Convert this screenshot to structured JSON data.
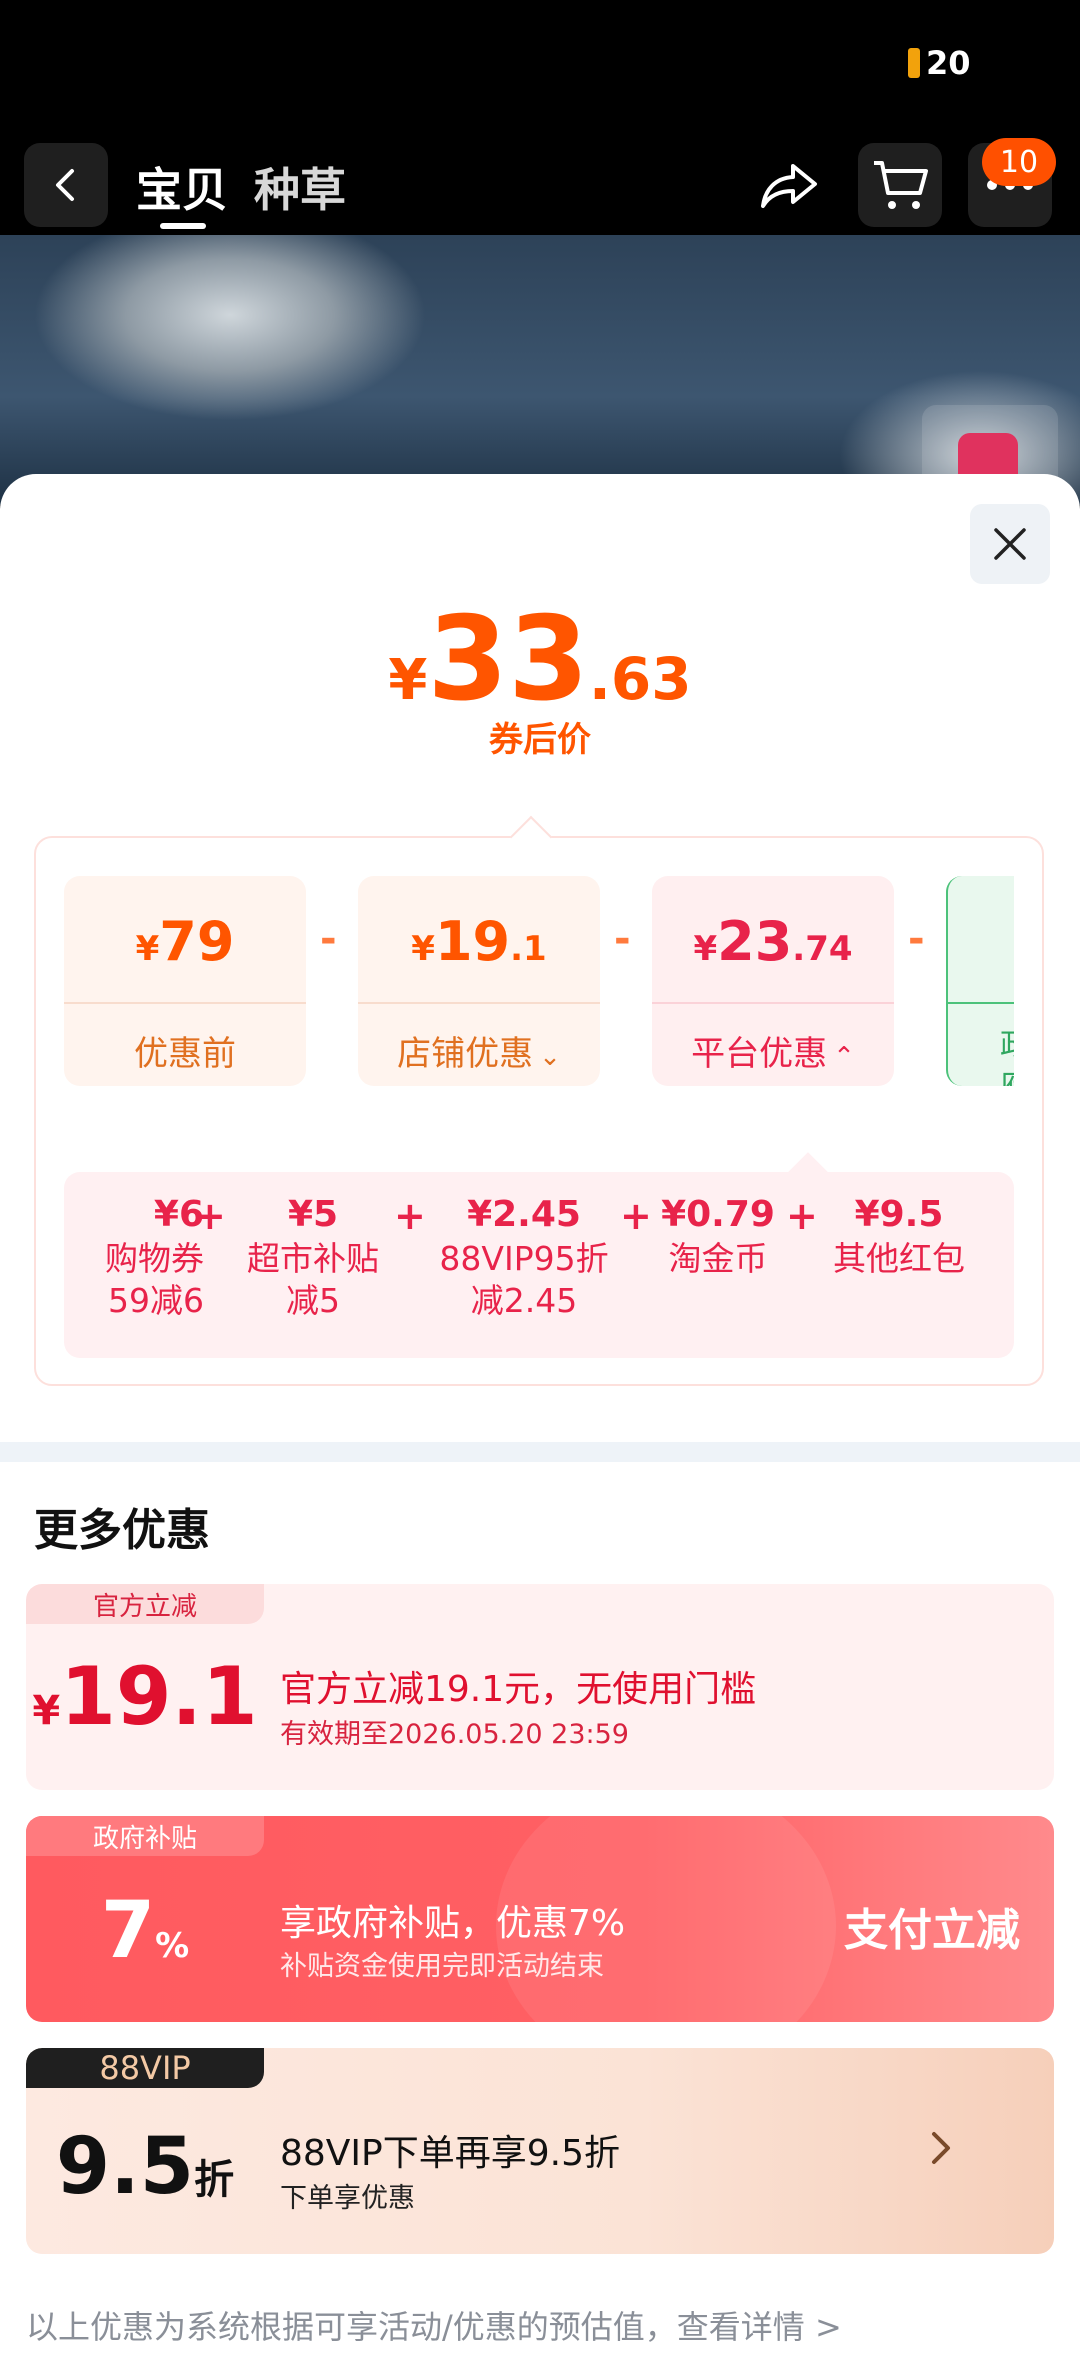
{
  "status_bar": {
    "battery_level": "20"
  },
  "nav": {
    "tabs": [
      "宝贝",
      "种草"
    ],
    "message_badge": "10"
  },
  "sheet": {
    "price": {
      "currency": "¥",
      "integer": "33",
      "decimal": ".63",
      "label": "券后价"
    },
    "breakdown": [
      {
        "currency": "¥",
        "integer": "79",
        "decimal": "",
        "label": "优惠前",
        "expander": ""
      },
      {
        "currency": "¥",
        "integer": "19",
        "decimal": ".1",
        "label": "店铺优惠",
        "expander": "⌄"
      },
      {
        "currency": "¥",
        "integer": "23",
        "decimal": ".74",
        "label": "平台优惠",
        "expander": "⌃"
      },
      {
        "currency": "",
        "integer": "",
        "decimal": "",
        "label": "政府",
        "expander": ""
      }
    ],
    "platform_details": [
      {
        "value": "¥6",
        "line1": "购物券",
        "line2": "59减6"
      },
      {
        "value": "¥5",
        "line1": "超市补贴",
        "line2": "减5"
      },
      {
        "value": "¥2.45",
        "line1": "88VIP95折",
        "line2": "减2.45"
      },
      {
        "value": "¥0.79",
        "line1": "淘金币",
        "line2": ""
      },
      {
        "value": "¥9.5",
        "line1": "其他红包",
        "line2": ""
      }
    ],
    "operators": {
      "minus": "-",
      "plus": "+"
    },
    "more_title": "更多优惠",
    "offers": {
      "official": {
        "tag": "官方立减",
        "currency": "¥",
        "value": "19.1",
        "title": "官方立减19.1元，无使用门槛",
        "subtitle": "有效期至2026.05.20 23:59"
      },
      "gov": {
        "tag": "政府补贴",
        "value": "7",
        "unit": "%",
        "title": "享政府补贴，优惠7%",
        "subtitle": "补贴资金使用完即活动结束",
        "action": "支付立减"
      },
      "vip": {
        "tag": "88VIP",
        "value": "9.5",
        "unit": "折",
        "title": "88VIP下单再享9.5折",
        "subtitle": "下单享优惠"
      }
    },
    "footnote": "以上优惠为系统根据可享活动/优惠的预估值，查看详情 >"
  },
  "colors": {
    "brand_orange": "#ff5500",
    "platform_red": "#e8234a",
    "gov_red": "#ff5a5f",
    "gov_green": "#2fa75f"
  },
  "icons": [
    "back-icon",
    "share-icon",
    "cart-icon",
    "more-icon",
    "close-icon",
    "chevron-right-icon"
  ]
}
